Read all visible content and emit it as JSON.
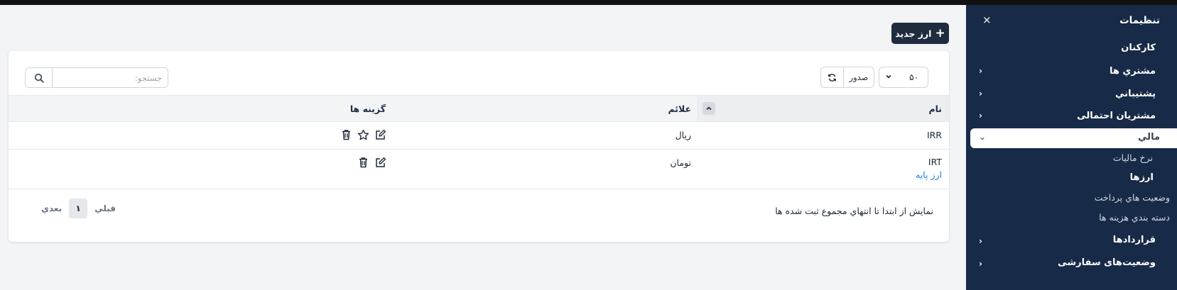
{
  "sidebar": {
    "title": "تنظيمات",
    "close_icon": "×",
    "items": [
      {
        "label": "کارکنان"
      },
      {
        "label": "مشتري ها"
      },
      {
        "label": "پشتيباني"
      },
      {
        "label": "مشتريان احتمالی"
      },
      {
        "label": "مالي"
      },
      {
        "label": "قراردادها"
      },
      {
        "label": "وضعیت‌های سفارشی"
      }
    ],
    "sub_items": [
      {
        "label": "نرخ ماليات"
      },
      {
        "label": "ارزها"
      },
      {
        "label": "وضعيت هاي پرداخت"
      },
      {
        "label": "دسته بندي هزينه ها"
      }
    ]
  },
  "toolbar": {
    "new_button_label": "ارز جديد",
    "page_size": "۵۰",
    "export_label": "صدور",
    "search_placeholder": "جستجو:"
  },
  "table": {
    "columns": [
      "نام",
      "علائم",
      "گزينه ها"
    ],
    "rows": [
      {
        "name": "IRR",
        "symbol": "ريال",
        "badge": ""
      },
      {
        "name": "IRT",
        "symbol": "تومان",
        "badge": "ارز پايه"
      }
    ]
  },
  "footer": {
    "info": "نمايش از ابتدا تا انتهاي مجموع ثبت شده ها",
    "prev_label": "قبلي",
    "page": "۱",
    "next_label": "بعدي"
  },
  "colors": {
    "sidebar_bg": "#172a47",
    "primary_button": "#1f2c3f",
    "link": "#1d7fd6"
  }
}
